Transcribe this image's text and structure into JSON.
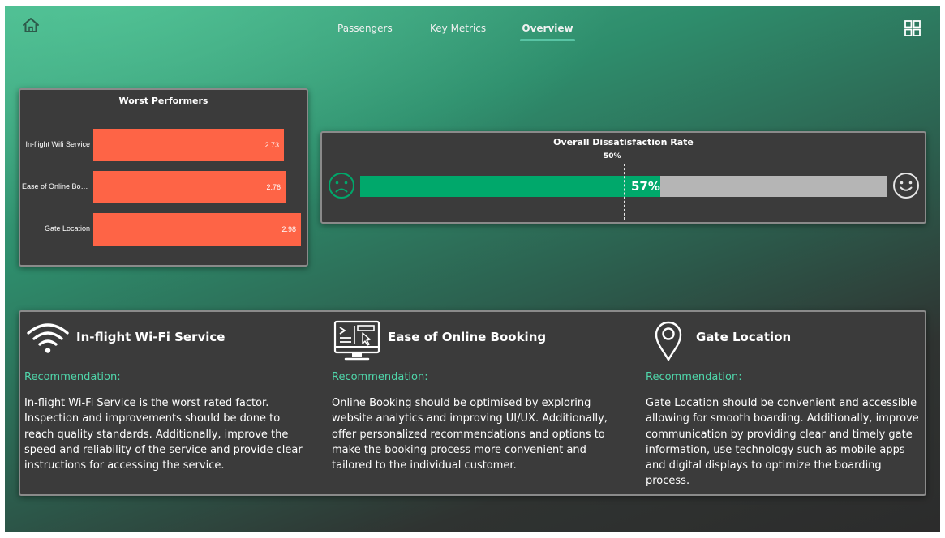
{
  "nav": {
    "tabs": [
      {
        "label": "Passengers"
      },
      {
        "label": "Key Metrics"
      },
      {
        "label": "Overview"
      }
    ],
    "active_tab": "Overview",
    "accent_color": "#58c4a4"
  },
  "icons": {
    "home": "home-icon",
    "grid": "grid-icon"
  },
  "worst_performers": {
    "title": "Worst Performers",
    "bar_color": "#fe6446",
    "chart_data": {
      "type": "bar",
      "orientation": "horizontal",
      "title": "Worst Performers",
      "categories": [
        "In-flight Wifi Service",
        "Ease of Online Boo...",
        "Gate Location"
      ],
      "values": [
        2.73,
        2.76,
        2.98
      ],
      "value_labels": [
        "2.73",
        "2.76",
        "2.98"
      ]
    }
  },
  "dissatisfaction": {
    "title": "Overall Dissatisfaction Rate",
    "value": 0.57,
    "value_label": "57%",
    "target": 0.5,
    "target_label": "50%",
    "fill_color": "#00a86b",
    "track_color": "#b5b5b5",
    "left_icon": "sad-face-icon",
    "right_icon": "happy-face-icon"
  },
  "recommendations": [
    {
      "icon": "wifi-icon",
      "title": "In-flight Wi-Fi Service",
      "label": "Recommendation:",
      "text": "In-flight Wi-Fi Service is the worst rated factor. Inspection and improvements should be done to reach quality standards. Additionally, improve the speed and reliability of the service and provide clear instructions for accessing the service."
    },
    {
      "icon": "online-booking-icon",
      "title": "Ease of Online Booking",
      "label": "Recommendation:",
      "text": "Online Booking should be optimised by exploring website analytics and improving UI/UX. Additionally, offer personalized recommendations and options to make the booking process more convenient and tailored to the individual customer."
    },
    {
      "icon": "location-pin-icon",
      "title": "Gate Location",
      "label": "Recommendation:",
      "text": "Gate Location should be convenient and accessible allowing for smooth boarding. Additionally, improve communication by providing clear and timely gate information, use technology such as mobile apps and digital displays to optimize the boarding process."
    }
  ]
}
